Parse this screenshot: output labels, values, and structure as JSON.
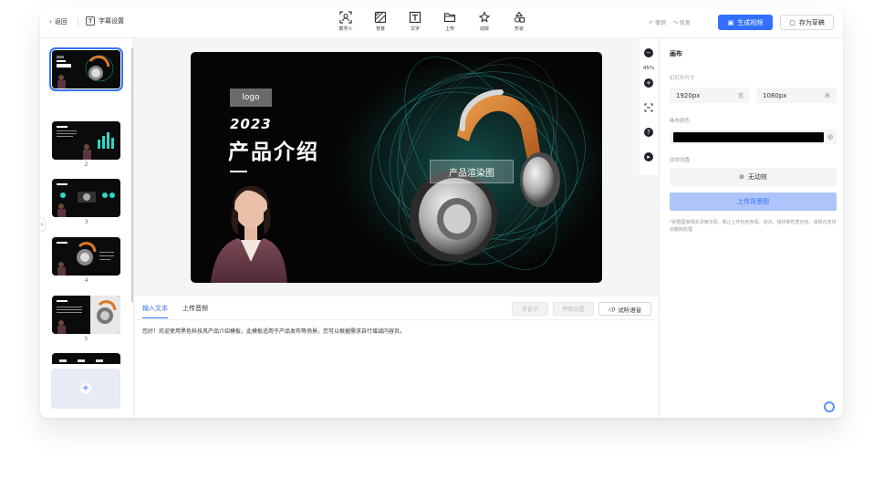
{
  "topbar": {
    "back_label": "返回",
    "subtitle_label": "字幕设置",
    "subtitle_icon": "T",
    "tools": [
      {
        "label": "数字人",
        "icon": "digital-human-icon"
      },
      {
        "label": "背景",
        "icon": "background-icon"
      },
      {
        "label": "文字",
        "icon": "text-icon"
      },
      {
        "label": "上传",
        "icon": "folder-upload-icon"
      },
      {
        "label": "动效",
        "icon": "sparkle-icon"
      },
      {
        "label": "形状",
        "icon": "shapes-icon"
      }
    ],
    "undo_label": "撤销",
    "redo_label": "恢复",
    "generate_label": "生成视频",
    "draft_label": "存为草稿"
  },
  "slides": {
    "items": [
      {
        "num": "1",
        "selected": true
      },
      {
        "num": "2",
        "selected": false
      },
      {
        "num": "3",
        "selected": false
      },
      {
        "num": "4",
        "selected": false
      },
      {
        "num": "5",
        "selected": false
      }
    ],
    "add_icon": "+"
  },
  "canvas": {
    "logo_text": "logo",
    "year": "2023",
    "title": "产品介绍",
    "render_label": "产品渲染图"
  },
  "zoom": {
    "percent": "45%"
  },
  "script": {
    "tab_text": "输入文本",
    "tab_audio": "上传音频",
    "polyphone": "多音字",
    "pause": "停顿设置",
    "listen": "试听语音",
    "text": "您好！欢迎使用黑色科技风产品介绍模板，此模板适用于产品发布等场景，您可以根据需求自行增减内容页。"
  },
  "right_panel": {
    "title": "画布",
    "size_label": "幻灯片尺寸",
    "width_value": "1920px",
    "width_unit": "宽",
    "height_value": "1080px",
    "height_unit": "高",
    "color_label": "画布颜色",
    "color_value": "#000000",
    "anim_label": "动效设置",
    "anim_value": "无动效",
    "upload_label": "上传背景图",
    "notice": "*依据国家相关法律法规，禁止上传包含色情、违法、侵权等性质内容，违规内容将会删除处理"
  },
  "colors": {
    "accent": "#3370ff",
    "teal_glow": "#2fd6c9",
    "orange_band": "#d9782a"
  }
}
